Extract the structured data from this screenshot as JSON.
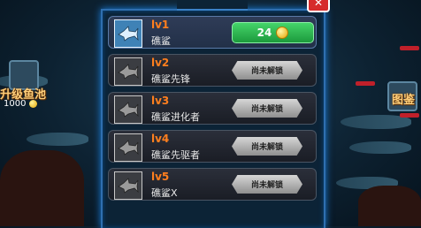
{
  "side": {
    "left_label": "升级鱼池",
    "left_count": "1000",
    "right_label": "图鉴"
  },
  "close_label": "✕",
  "levels": [
    {
      "level": "lv1",
      "name": "礁鲨",
      "action": "24",
      "unlocked": true
    },
    {
      "level": "lv2",
      "name": "礁鲨先锋",
      "action": "尚未解锁",
      "unlocked": false
    },
    {
      "level": "lv3",
      "name": "礁鲨进化者",
      "action": "尚未解锁",
      "unlocked": false
    },
    {
      "level": "lv4",
      "name": "礁鲨先驱者",
      "action": "尚未解锁",
      "unlocked": false
    },
    {
      "level": "lv5",
      "name": "礁鲨X",
      "action": "尚未解锁",
      "unlocked": false
    }
  ],
  "colors": {
    "level_text": "#ff7f1e",
    "buy_button": "#2dbb52",
    "panel_border": "#2f6fb0"
  },
  "icons": {
    "thumb": "shark-icon",
    "coin": "gold-coin-icon",
    "close": "close-icon"
  }
}
